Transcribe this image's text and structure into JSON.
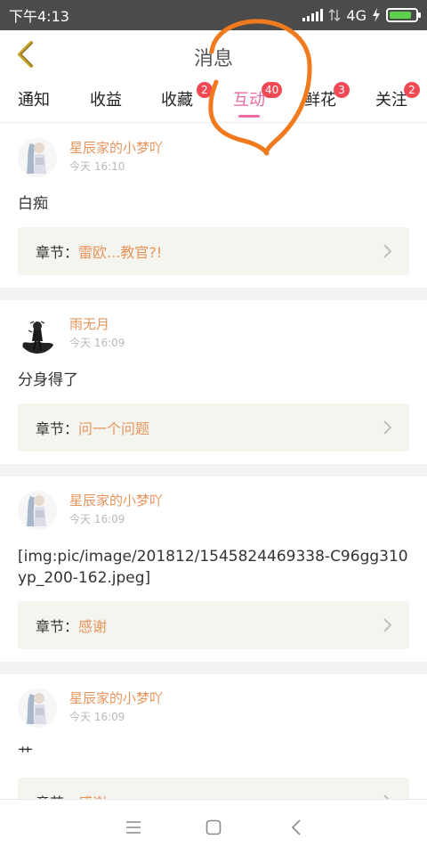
{
  "status_bar": {
    "time": "下午4:13",
    "network": "4G",
    "battery_level": 0.85,
    "battery_color": "#5bd24a"
  },
  "header": {
    "title": "消息",
    "back_icon": "chevron-left-icon",
    "accent_color": "#c9a22d"
  },
  "tabs": [
    {
      "label": "通知",
      "badge": ""
    },
    {
      "label": "收益",
      "badge": ""
    },
    {
      "label": "收藏",
      "badge": "2"
    },
    {
      "label": "互动",
      "badge": "40",
      "active": true
    },
    {
      "label": "鲜花",
      "badge": "3"
    },
    {
      "label": "关注",
      "badge": "2"
    }
  ],
  "items": [
    {
      "user": "星辰家的小梦吖",
      "time": "今天 16:10",
      "message": "白痴",
      "chapter_label": "章节：",
      "chapter_title": "雷欧...教官?!"
    },
    {
      "user": "雨无月",
      "time": "今天 16:09",
      "message": "分身得了",
      "chapter_label": "章节：",
      "chapter_title": "问一个问题"
    },
    {
      "user": "星辰家的小梦吖",
      "time": "今天 16:09",
      "message": "[img:pic/image/201812/1545824469338-C96gg310yp_200-162.jpeg]",
      "chapter_label": "章节：",
      "chapter_title": "感谢"
    },
    {
      "user": "星辰家的小梦吖",
      "time": "今天 16:09",
      "message": "艹",
      "chapter_label": "章节：",
      "chapter_title": "感谢"
    }
  ],
  "colors": {
    "username": "#e6945c",
    "active_tab": "#e96aa4",
    "badge": "#f24a55",
    "annotation": "#f07a1d"
  }
}
